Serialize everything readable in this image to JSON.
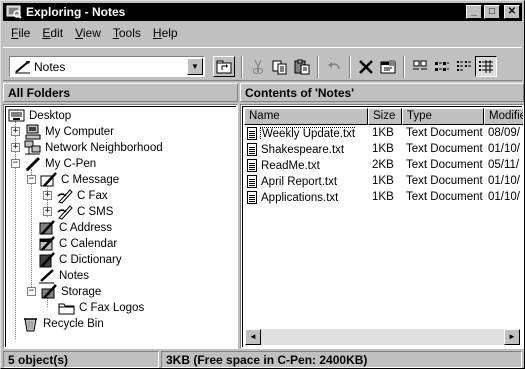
{
  "window": {
    "title": "Exploring - Notes",
    "minimize_glyph": "_",
    "maximize_glyph": "□",
    "close_glyph": "✕"
  },
  "menu": [
    "File",
    "Edit",
    "View",
    "Tools",
    "Help"
  ],
  "toolbar": {
    "location_value": "Notes",
    "dropdown_glyph": "▼",
    "buttons": [
      "up-folder",
      "cut",
      "copy",
      "paste",
      "undo",
      "delete",
      "properties",
      "large-icons",
      "small-icons",
      "list",
      "details"
    ]
  },
  "left_pane": {
    "header": "All Folders",
    "tree": [
      {
        "label": "Desktop",
        "icon": "desktop-icon",
        "expander": ""
      },
      {
        "label": "My Computer",
        "icon": "computer-icon",
        "expander": "+"
      },
      {
        "label": "Network Neighborhood",
        "icon": "network-icon",
        "expander": "+"
      },
      {
        "label": "My C-Pen",
        "icon": "pen-icon",
        "expander": "−"
      },
      {
        "label": "C Message",
        "icon": "message-icon",
        "expander": "−"
      },
      {
        "label": "C Fax",
        "icon": "fax-icon",
        "expander": "+"
      },
      {
        "label": "C SMS",
        "icon": "sms-icon",
        "expander": "+"
      },
      {
        "label": "C Address",
        "icon": "address-icon",
        "expander": ""
      },
      {
        "label": "C Calendar",
        "icon": "calendar-icon",
        "expander": ""
      },
      {
        "label": "C Dictionary",
        "icon": "dictionary-icon",
        "expander": ""
      },
      {
        "label": "Notes",
        "icon": "notes-icon",
        "expander": ""
      },
      {
        "label": "Storage",
        "icon": "storage-icon",
        "expander": "−"
      },
      {
        "label": "C Fax Logos",
        "icon": "folder-icon",
        "expander": ""
      },
      {
        "label": "Recycle Bin",
        "icon": "recycle-bin-icon",
        "expander": ""
      }
    ]
  },
  "right_pane": {
    "header": "Contents of 'Notes'",
    "columns": [
      "Name",
      "Size",
      "Type",
      "Modifie"
    ],
    "files": [
      {
        "name": "Weekly Update.txt",
        "size": "1KB",
        "type": "Text Document",
        "modified": "08/09/"
      },
      {
        "name": "Shakespeare.txt",
        "size": "1KB",
        "type": "Text Document",
        "modified": "01/10/"
      },
      {
        "name": "ReadMe.txt",
        "size": "2KB",
        "type": "Text Document",
        "modified": "05/11/"
      },
      {
        "name": "April Report.txt",
        "size": "1KB",
        "type": "Text Document",
        "modified": "01/10/"
      },
      {
        "name": "Applications.txt",
        "size": "1KB",
        "type": "Text Document",
        "modified": "01/10/"
      }
    ],
    "scroll_left_glyph": "◄",
    "scroll_right_glyph": "►"
  },
  "status": {
    "count": "5 object(s)",
    "space": "3KB (Free space in C-Pen: 2400KB)"
  }
}
